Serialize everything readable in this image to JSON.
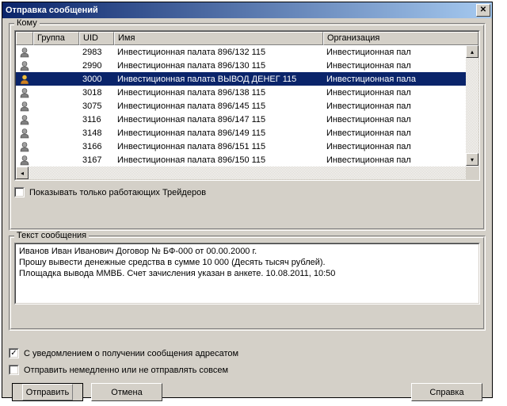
{
  "title": "Отправка сообщений",
  "group_to": {
    "label": "Кому",
    "columns": {
      "group": "Группа",
      "uid": "UID",
      "name": "Имя",
      "org": "Организация"
    },
    "rows": [
      {
        "uid": "2983",
        "name": "Инвестиционная палата 896/132 115",
        "org": "Инвестиционная пал"
      },
      {
        "uid": "2990",
        "name": "Инвестиционная палата 896/130 115",
        "org": "Инвестиционная пал"
      },
      {
        "uid": "3000",
        "name": "Инвестиционная палата ВЫВОД ДЕНЕГ 115",
        "org": "Инвестиционная пала",
        "selected": true,
        "special": true
      },
      {
        "uid": "3018",
        "name": "Инвестиционная палата 896/138 115",
        "org": "Инвестиционная пал"
      },
      {
        "uid": "3075",
        "name": "Инвестиционная палата 896/145 115",
        "org": "Инвестиционная пал"
      },
      {
        "uid": "3116",
        "name": "Инвестиционная палата 896/147 115",
        "org": "Инвестиционная пал"
      },
      {
        "uid": "3148",
        "name": "Инвестиционная палата 896/149 115",
        "org": "Инвестиционная пал"
      },
      {
        "uid": "3166",
        "name": "Инвестиционная палата 896/151 115",
        "org": "Инвестиционная пал"
      },
      {
        "uid": "3167",
        "name": "Инвестиционная палата 896/150 115",
        "org": "Инвестиционная пал"
      }
    ],
    "filter_label": "Показывать только работающих Трейдеров",
    "filter_checked": false
  },
  "message": {
    "label": "Текст сообщения",
    "text": "Иванов Иван Иванович Договор № БФ-000 от 00.00.2000 г.\nПрошу вывести денежные средства в сумме 10 000 (Десять тысяч рублей).\nПлощадка вывода ММВБ. Счет зачисления указан в анкете. 10.08.2011, 10:50"
  },
  "options": {
    "notify_label": "С уведомлением о получении сообщения адресатом",
    "notify_checked": true,
    "immediate_label": "Отправить немедленно или не отправлять совсем",
    "immediate_checked": false
  },
  "buttons": {
    "send": "Отправить",
    "cancel": "Отмена",
    "help": "Справка"
  }
}
